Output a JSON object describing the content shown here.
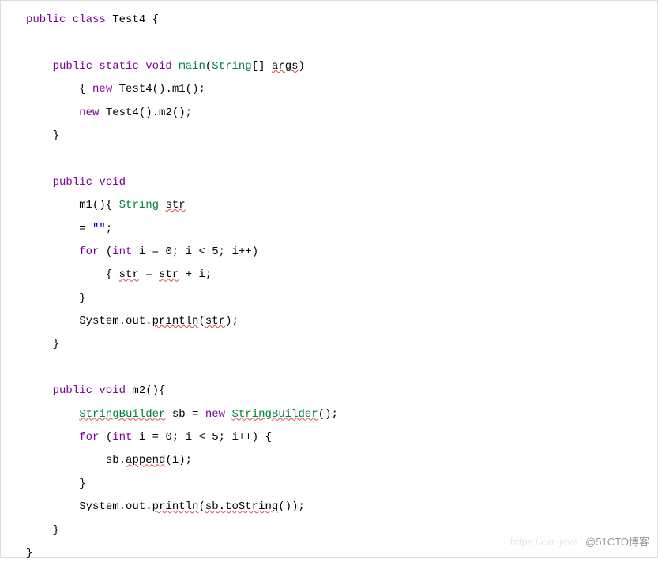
{
  "code": {
    "class_kw": "public class",
    "class_name": "Test4",
    "open_brace": " {",
    "main_mod": "public static void",
    "main_name": "main",
    "main_sig1": "(",
    "main_type": "String",
    "main_sig2": "[] ",
    "main_arg": "args",
    "main_sig3": ")",
    "main_b1a": "{ ",
    "main_b1_new": "new",
    "main_b1_rest": " Test4().m1();",
    "main_b2_new": "new",
    "main_b2_rest": " Test4().m2();",
    "close_brace": "}",
    "m1_mod": "public void",
    "m1_name": "m1",
    "m1_sig_open": "(){ ",
    "m1_strtype": "String",
    "m1_strvar": "str",
    "m1_assign": "= ",
    "m1_strlit": "\"\"",
    "m1_semi": ";",
    "for_kw": "for",
    "for_open": " (",
    "int_kw": "int",
    "for_init": " i = 0; i < 5; i++)",
    "m1_loop_a": "{ ",
    "m1_loop_str1": "str",
    "m1_loop_eq": " = ",
    "m1_loop_str2": "str",
    "m1_loop_rest": " + i;",
    "sysout": "System.out.",
    "println": "println",
    "m1_print_arg_a": "(",
    "m1_print_arg_str": "str",
    "m1_print_arg_b": ");",
    "m2_name": " m2(){",
    "sb_type": "StringBuilder",
    "sb_mid": " sb = ",
    "sb_new": "new",
    "sb_ctor": "StringBuilder",
    "sb_ctor2": "();",
    "for_body_open": " {",
    "m2_append_a": "sb.",
    "m2_append_fn": "append",
    "m2_append_b": "(i);",
    "m2_print_a": "(",
    "m2_print_fn": "sb.toString",
    "m2_print_b": "());"
  },
  "watermark_faint": "https://cwl-java",
  "watermark": "@51CTO博客"
}
